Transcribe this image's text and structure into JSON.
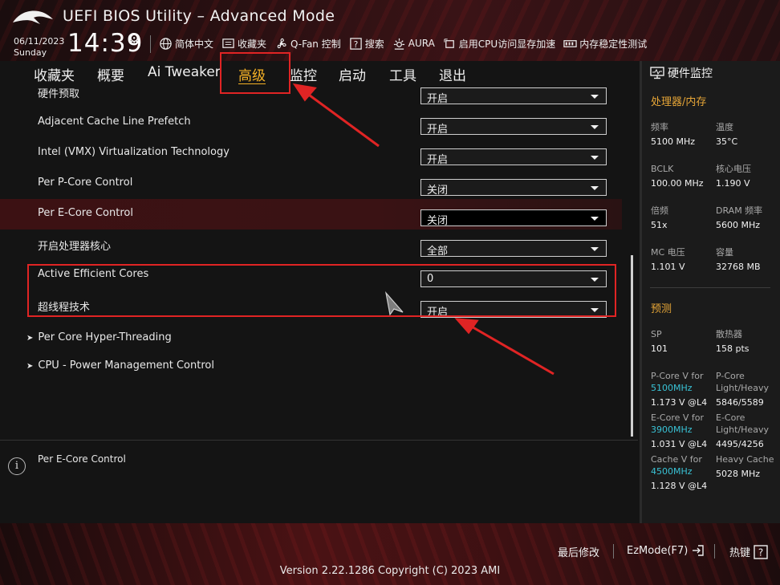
{
  "header": {
    "title": "UEFI BIOS Utility – Advanced Mode",
    "date": "06/11/2023",
    "day": "Sunday",
    "time": "14:39",
    "toolbar": [
      {
        "label": "简体中文",
        "icon": "globe-icon"
      },
      {
        "label": "收藏夹",
        "icon": "favorites-icon"
      },
      {
        "label": "Q-Fan 控制",
        "icon": "fan-icon"
      },
      {
        "label": "搜索",
        "icon": "help-search-icon"
      },
      {
        "label": "AURA",
        "icon": "aura-icon"
      },
      {
        "label": "启用CPU访问显存加速",
        "icon": "resize-bar-icon"
      },
      {
        "label": "内存稳定性测试",
        "icon": "memory-test-icon"
      }
    ]
  },
  "nav": {
    "tabs": [
      "收藏夹",
      "概要",
      "Ai Tweaker",
      "高级",
      "监控",
      "启动",
      "工具",
      "退出"
    ],
    "active": "高级"
  },
  "settings": [
    {
      "label": "硬件预取",
      "value": "开启"
    },
    {
      "label": "Adjacent Cache Line Prefetch",
      "value": "开启"
    },
    {
      "label": "Intel (VMX) Virtualization Technology",
      "value": "开启"
    },
    {
      "label": "Per P-Core Control",
      "value": "关闭"
    },
    {
      "label": "Per E-Core Control",
      "value": "关闭"
    },
    {
      "label": "开启处理器核心",
      "value": "全部"
    },
    {
      "label": "Active Efficient Cores",
      "value": "0"
    },
    {
      "label": "超线程技术",
      "value": "开启"
    }
  ],
  "submenus": [
    "Per Core Hyper-Threading",
    "CPU - Power Management Control"
  ],
  "help": {
    "text": "Per E-Core Control"
  },
  "panel": {
    "title": "硬件监控",
    "cpu_mem_title": "处理器/内存",
    "metrics": [
      {
        "label": "频率",
        "value": "5100 MHz"
      },
      {
        "label": "温度",
        "value": "35°C"
      },
      {
        "label": "BCLK",
        "value": "100.00 MHz"
      },
      {
        "label": "核心电压",
        "value": "1.190 V"
      },
      {
        "label": "倍频",
        "value": "51x"
      },
      {
        "label": "DRAM 频率",
        "value": "5600 MHz"
      },
      {
        "label": "MC 电压",
        "value": "1.101 V"
      },
      {
        "label": "容量",
        "value": "32768 MB"
      }
    ],
    "prediction_title": "预测",
    "sp_label": "SP",
    "sp_value": "101",
    "cooler_label": "散热器",
    "cooler_value": "158 pts",
    "pcore_v_label": "P-Core V for",
    "pcore_v_freq": "5100MHz",
    "pcore_v_value": "1.173 V @L4",
    "pcore_lh_label": "P-Core Light/Heavy",
    "pcore_lh_value": "5846/5589",
    "ecore_v_label": "E-Core V for",
    "ecore_v_freq": "3900MHz",
    "ecore_v_value": "1.031 V @L4",
    "ecore_lh_label": "E-Core Light/Heavy",
    "ecore_lh_value": "4495/4256",
    "cache_v_label": "Cache V for",
    "cache_v_freq": "4500MHz",
    "cache_v_value": "1.128 V @L4",
    "heavy_cache_label": "Heavy Cache",
    "heavy_cache_value": "5028 MHz"
  },
  "footer": {
    "last_modified": "最后修改",
    "ezmode": "EzMode(F7)",
    "hotkeys": "热键",
    "version": "Version 2.22.1286 Copyright (C) 2023 AMI"
  },
  "colors": {
    "accent": "#f6b226",
    "section_title": "#e7a637",
    "highlight_red": "#e02424",
    "cyan_freq": "#39c3d6"
  }
}
